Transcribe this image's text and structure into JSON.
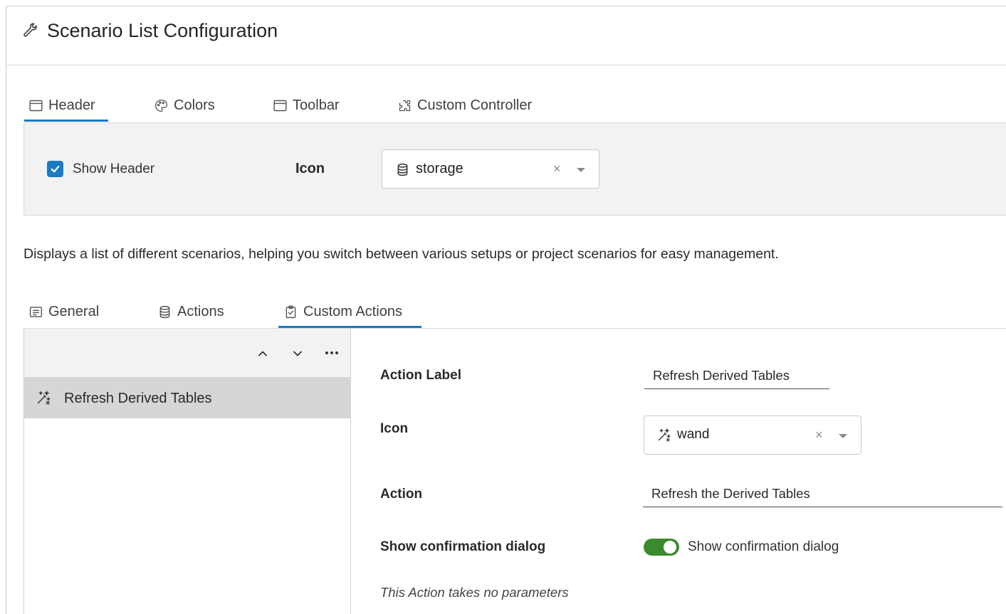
{
  "title": "Scenario List Configuration",
  "top_tabs": [
    {
      "label": "Header",
      "icon": "window-icon",
      "active": true
    },
    {
      "label": "Colors",
      "icon": "palette-icon",
      "active": false
    },
    {
      "label": "Toolbar",
      "icon": "window-icon",
      "active": false
    },
    {
      "label": "Custom Controller",
      "icon": "puzzle-icon",
      "active": false
    }
  ],
  "header_panel": {
    "show_header_label": "Show Header",
    "show_header_checked": true,
    "icon_label": "Icon",
    "icon_select": {
      "value": "storage",
      "icon": "storage-icon",
      "clear": "×"
    }
  },
  "description": "Displays a list of different scenarios, helping you switch between various setups or project scenarios for easy management.",
  "sub_tabs": [
    {
      "label": "General",
      "icon": "list-icon",
      "active": false
    },
    {
      "label": "Actions",
      "icon": "storage-icon",
      "active": false
    },
    {
      "label": "Custom Actions",
      "icon": "clipboard-check-icon",
      "active": true
    }
  ],
  "actions_list": {
    "toolbar": [
      "chevron-up-icon",
      "chevron-down-icon",
      "more-icon"
    ],
    "items": [
      {
        "label": "Refresh Derived Tables",
        "icon": "wand-icon",
        "selected": true
      }
    ]
  },
  "form": {
    "action_label": {
      "label": "Action Label",
      "value": "Refresh Derived Tables"
    },
    "icon": {
      "label": "Icon",
      "value": "wand",
      "icon": "wand-icon",
      "clear": "×"
    },
    "action": {
      "label": "Action",
      "value": "Refresh the Derived Tables"
    },
    "confirmation": {
      "label": "Show confirmation dialog",
      "toggle_label": "Show confirmation dialog",
      "on": true
    },
    "no_params_text": "This Action takes no parameters"
  },
  "colors": {
    "accent": "#1a7bc4",
    "toggle_on": "#3c8a2e",
    "panel_bg": "#f2f2f2",
    "selected_row": "#d6d6d6"
  }
}
